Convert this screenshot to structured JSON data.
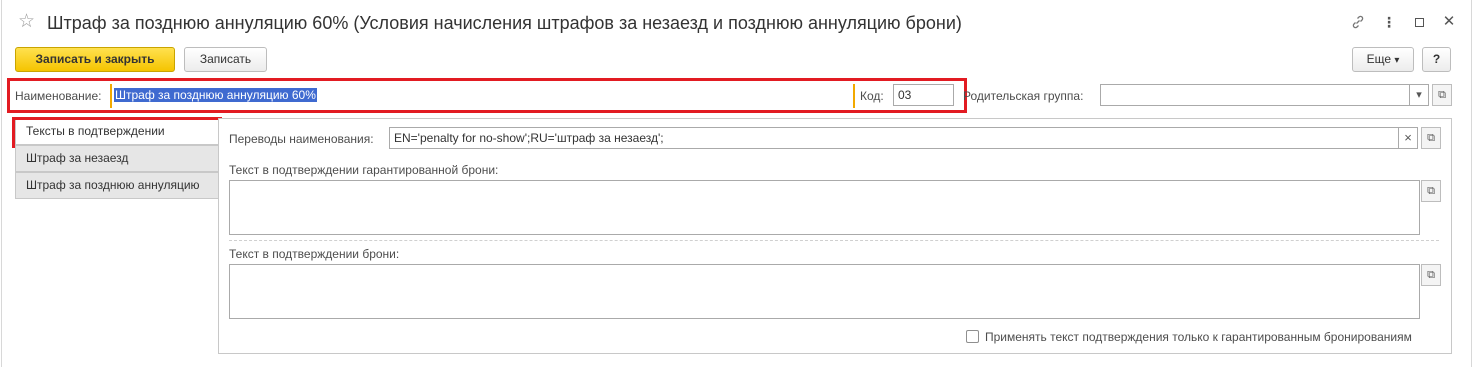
{
  "window": {
    "title": "Штраф за позднюю аннуляцию 60% (Условия начисления штрафов за незаезд и позднюю аннуляцию брони)",
    "star_icon": "☆",
    "link_icon": "🔗",
    "more_icon": "⋮",
    "maximize_icon": "☐",
    "close_icon": "✕"
  },
  "toolbar": {
    "save_close_label": "Записать и закрыть",
    "save_label": "Записать",
    "more_label": "Еще",
    "more_arrow": "▾",
    "help_label": "?"
  },
  "fields": {
    "name_label": "Наименование:",
    "name_value": "Штраф за позднюю аннуляцию 60%",
    "code_label": "Код:",
    "code_value": "03",
    "parent_label": "Родительская группа:",
    "parent_value": "",
    "dropdown_arrow": "▾",
    "open_icon": "⧉"
  },
  "tabs": [
    {
      "label": "Тексты в подтверждении",
      "active": true
    },
    {
      "label": "Штраф за незаезд",
      "active": false
    },
    {
      "label": "Штраф за позднюю аннуляцию",
      "active": false
    }
  ],
  "panel": {
    "translations_label": "Переводы наименования:",
    "translations_value": "EN='penalty for no-show';RU='штраф за незаезд';",
    "clear_icon": "×",
    "open_icon": "⧉",
    "guaranteed_text_label": "Текст в подтверждении гарантированной брони:",
    "guaranteed_text_value": "",
    "booking_text_label": "Текст в подтверждении брони:",
    "booking_text_value": "",
    "checkbox_label": "Применять текст подтверждения только к гарантированным бронированиям",
    "checkbox_checked": false
  }
}
